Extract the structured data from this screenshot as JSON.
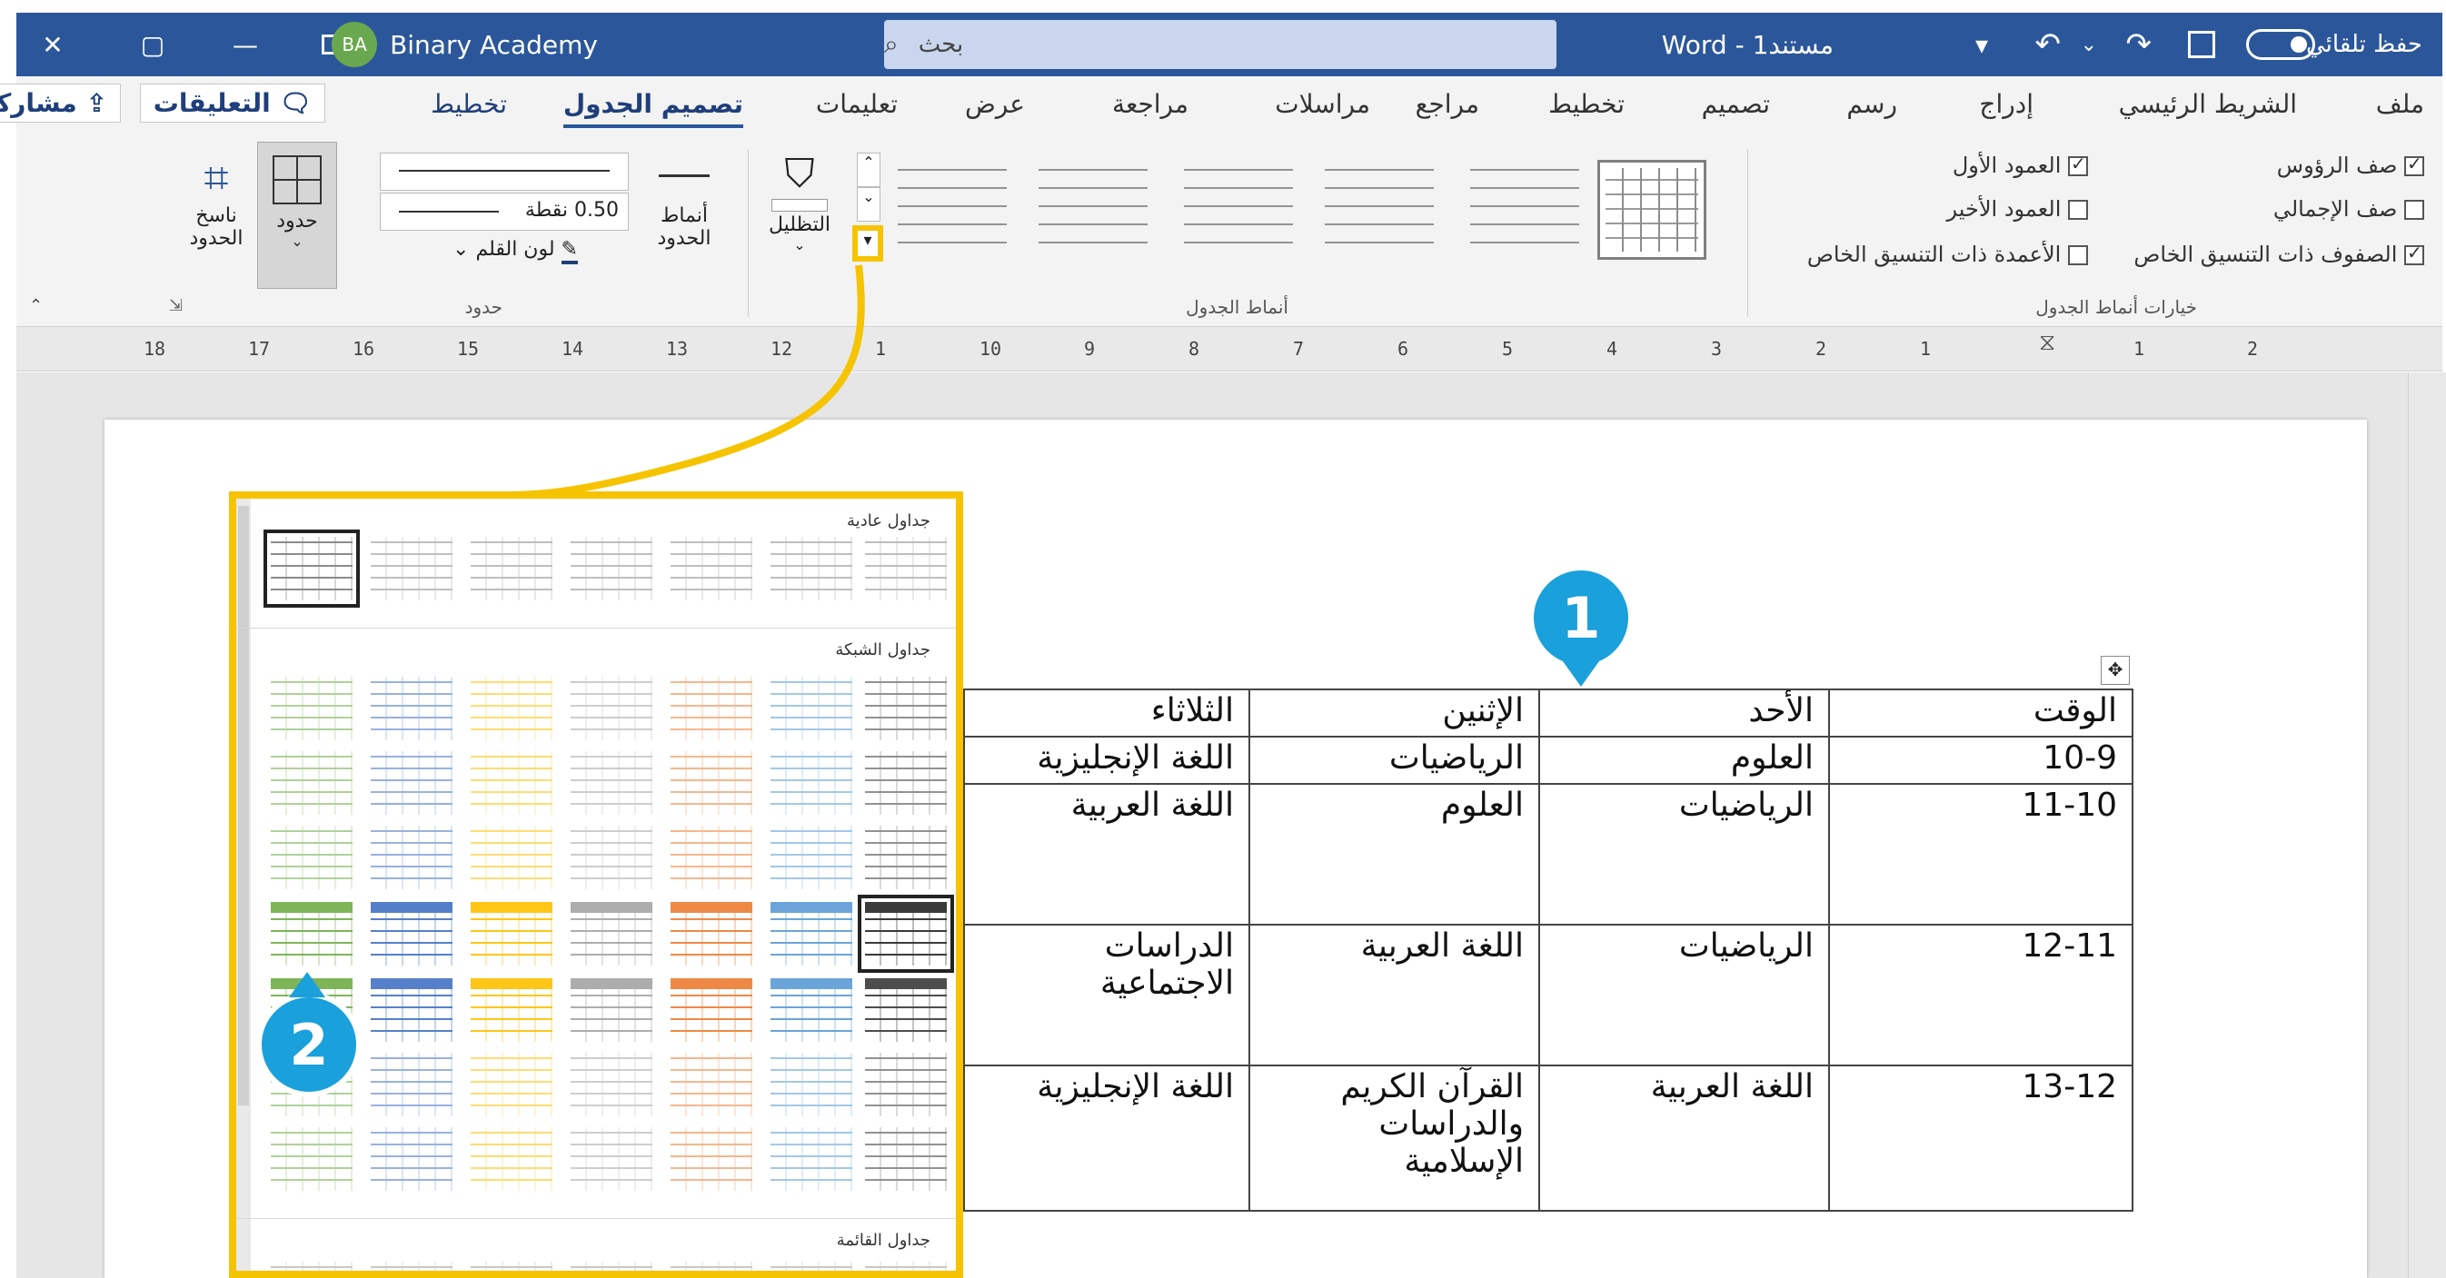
{
  "titlebar": {
    "close_glyph": "✕",
    "restore_glyph": "▢",
    "minimize_glyph": "—",
    "avatar_initials": "BA",
    "user_name": "Binary Academy",
    "search_placeholder": "بحث",
    "doc_title": "مستند1 - Word",
    "autosave_label": "حفظ تلقائي"
  },
  "tabs": {
    "file": "ملف",
    "home": "الشريط الرئيسي",
    "insert": "إدراج",
    "draw": "رسم",
    "design": "تصميم",
    "layout": "تخطيط",
    "references": "مراجع",
    "mailings": "مراسلات",
    "review": "مراجعة",
    "view": "عرض",
    "help": "تعليمات",
    "table_design": "تصميم الجدول",
    "table_layout": "تخطيط",
    "comments": "التعليقات",
    "share": "مشاركة"
  },
  "ribbon": {
    "opt_header_row": "صف الرؤوس",
    "opt_total_row": "صف الإجمالي",
    "opt_banded_rows": "الصفوف ذات التنسيق الخاص",
    "opt_first_column": "العمود الأول",
    "opt_last_column": "العمود الأخير",
    "opt_banded_columns": "الأعمدة ذات التنسيق الخاص",
    "group_style_options": "خيارات أنماط الجدول",
    "group_table_styles": "أنماط الجدول",
    "group_borders": "حدود",
    "shading_label": "التظليل",
    "border_styles_label": "أنماط الحدود",
    "pen_weight": "0.50 نقطة",
    "pen_color_label": "لون القلم",
    "borders_label": "حدود",
    "border_painter_label": "ناسخ الحدود"
  },
  "ruler": {
    "numbers": [
      "18",
      "17",
      "16",
      "15",
      "14",
      "13",
      "12",
      "1",
      "10",
      "9",
      "8",
      "7",
      "6",
      "5",
      "4",
      "3",
      "2",
      "1",
      "1",
      "2"
    ]
  },
  "gallery": {
    "plain_tables": "جداول عادية",
    "grid_tables": "جداول الشبكة",
    "list_tables": "جداول القائمة",
    "grid_row_colors": [
      "#3a3a3a",
      "#5b9bd5",
      "#ed7d31",
      "#a5a5a5",
      "#ffc000",
      "#4472c4",
      "#70ad47"
    ]
  },
  "table": {
    "headers": [
      "الوقت",
      "الأحد",
      "الإثنين",
      "الثلاثاء"
    ],
    "rows": [
      [
        "10-9",
        "العلوم",
        "الرياضيات",
        "اللغة الإنجليزية"
      ],
      [
        "11-10",
        "الرياضيات",
        "العلوم",
        "اللغة العربية"
      ],
      [
        "12-11",
        "الرياضيات",
        "اللغة العربية",
        "الدراسات الاجتماعية"
      ],
      [
        "13-12",
        "اللغة العربية",
        "القرآن الكريم والدراسات الإسلامية",
        "اللغة الإنجليزية"
      ]
    ]
  },
  "callouts": {
    "one": "1",
    "two": "2"
  },
  "colors": {
    "title_bar": "#2b579a",
    "highlight": "#f6c300",
    "callout": "#1aa0db"
  }
}
